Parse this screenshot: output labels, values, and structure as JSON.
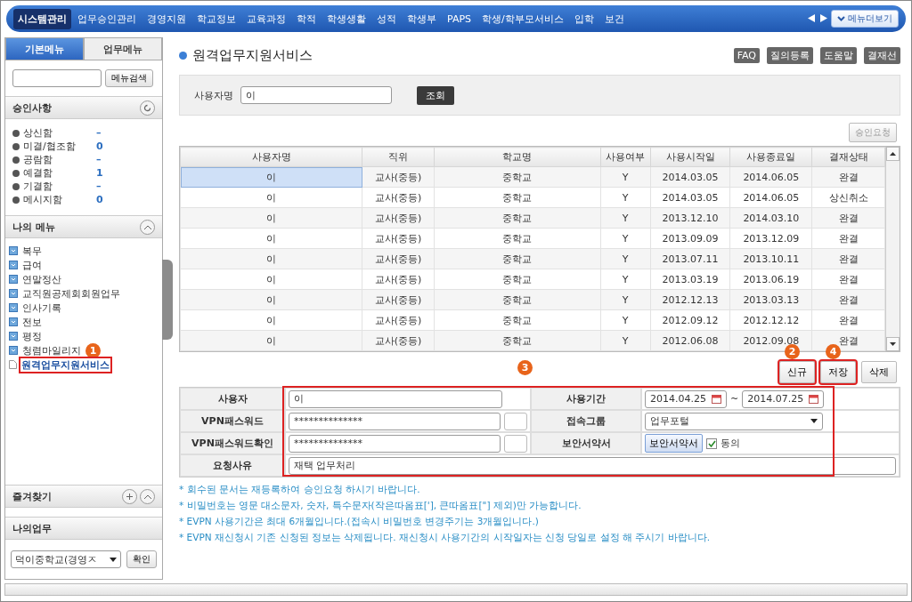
{
  "top_nav": {
    "items": [
      {
        "label": "시스템관리",
        "selected": true
      },
      {
        "label": "업무승인관리",
        "selected": false
      },
      {
        "label": "경영지원",
        "selected": false
      },
      {
        "label": "학교정보",
        "selected": false
      },
      {
        "label": "교육과정",
        "selected": false
      },
      {
        "label": "학적",
        "selected": false
      },
      {
        "label": "학생생활",
        "selected": false
      },
      {
        "label": "성적",
        "selected": false
      },
      {
        "label": "학생부",
        "selected": false
      },
      {
        "label": "PAPS",
        "selected": false
      },
      {
        "label": "학생/학부모서비스",
        "selected": false
      },
      {
        "label": "입학",
        "selected": false
      },
      {
        "label": "보건",
        "selected": false
      }
    ],
    "more_button": "메뉴더보기"
  },
  "sidebar": {
    "tabs": [
      {
        "label": "기본메뉴",
        "selected": true
      },
      {
        "label": "업무메뉴",
        "selected": false
      }
    ],
    "search_button": "메뉴검색",
    "approvals": {
      "title": "승인사항",
      "items": [
        {
          "label": "상신함",
          "count": "–"
        },
        {
          "label": "미결/협조함",
          "count": "0"
        },
        {
          "label": "공람함",
          "count": "–"
        },
        {
          "label": "예결함",
          "count": "1"
        },
        {
          "label": "기결함",
          "count": "–"
        },
        {
          "label": "메시지함",
          "count": "0"
        }
      ]
    },
    "my_menu": {
      "title": "나의 메뉴",
      "items": [
        {
          "label": "복무",
          "kind": "folder",
          "highlighted": false
        },
        {
          "label": "급여",
          "kind": "folder",
          "highlighted": false
        },
        {
          "label": "연말정산",
          "kind": "folder",
          "highlighted": false
        },
        {
          "label": "교직원공제회회원업무",
          "kind": "folder",
          "highlighted": false
        },
        {
          "label": "인사기록",
          "kind": "folder",
          "highlighted": false
        },
        {
          "label": "전보",
          "kind": "folder",
          "highlighted": false
        },
        {
          "label": "평정",
          "kind": "folder",
          "highlighted": false
        },
        {
          "label": "청렴마일리지",
          "kind": "folder",
          "highlighted": false,
          "marker": "1"
        },
        {
          "label": "원격업무지원서비스",
          "kind": "page",
          "highlighted": true
        }
      ]
    },
    "favorites": {
      "title": "즐겨찾기"
    },
    "my_work": {
      "title": "나의업무",
      "select_value": "덕이중학교(경영ㅈ",
      "confirm_button": "확인"
    }
  },
  "main": {
    "title": "원격업무지원서비스",
    "toolbar": [
      "FAQ",
      "질의등록",
      "도움말",
      "결재선"
    ],
    "search": {
      "label": "사용자명",
      "value": "이",
      "button": "조회"
    },
    "approve_button": "승인요청",
    "table": {
      "columns": [
        "사용자명",
        "직위",
        "학교명",
        "사용여부",
        "사용시작일",
        "사용종료일",
        "결재상태"
      ],
      "rows": [
        {
          "selected": true,
          "cells": [
            "이",
            "교사(중등)",
            "중학교",
            "Y",
            "2014.03.05",
            "2014.06.05",
            "완결"
          ]
        },
        {
          "selected": false,
          "cells": [
            "이",
            "교사(중등)",
            "중학교",
            "Y",
            "2014.03.05",
            "2014.06.05",
            "상신취소"
          ]
        },
        {
          "selected": false,
          "cells": [
            "이",
            "교사(중등)",
            "중학교",
            "Y",
            "2013.12.10",
            "2014.03.10",
            "완결"
          ]
        },
        {
          "selected": false,
          "cells": [
            "이",
            "교사(중등)",
            "중학교",
            "Y",
            "2013.09.09",
            "2013.12.09",
            "완결"
          ]
        },
        {
          "selected": false,
          "cells": [
            "이",
            "교사(중등)",
            "중학교",
            "Y",
            "2013.07.11",
            "2013.10.11",
            "완결"
          ]
        },
        {
          "selected": false,
          "cells": [
            "이",
            "교사(중등)",
            "중학교",
            "Y",
            "2013.03.19",
            "2013.06.19",
            "완결"
          ]
        },
        {
          "selected": false,
          "cells": [
            "이",
            "교사(중등)",
            "중학교",
            "Y",
            "2012.12.13",
            "2013.03.13",
            "완결"
          ]
        },
        {
          "selected": false,
          "cells": [
            "이",
            "교사(중등)",
            "중학교",
            "Y",
            "2012.09.12",
            "2012.12.12",
            "완결"
          ]
        },
        {
          "selected": false,
          "cells": [
            "이",
            "교사(중등)",
            "중학교",
            "Y",
            "2012.06.08",
            "2012.09.08",
            "완결"
          ]
        }
      ]
    },
    "form_marker": "3",
    "actions": [
      {
        "label": "신규",
        "highlighted": true,
        "marker": "2"
      },
      {
        "label": "저장",
        "highlighted": true,
        "marker": "4"
      },
      {
        "label": "삭제",
        "highlighted": false
      }
    ],
    "form": {
      "user_label": "사용자",
      "user_value": "이",
      "period_label": "사용기간",
      "period_start": "2014.04.25",
      "period_sep": "~",
      "period_end": "2014.07.25",
      "vpn_label": "VPN패스워드",
      "vpn_value": "**************",
      "group_label": "접속그룹",
      "group_value": "업무포털",
      "vpn_confirm_label": "VPN패스워드확인",
      "vpn_confirm_value": "**************",
      "agreement_label": "보안서약서",
      "agreement_button": "보안서약서",
      "agree_label": "동의",
      "agree_checked": true,
      "reason_label": "요청사유",
      "reason_value": "재택 업무처리"
    },
    "notes": [
      "* 회수된 문서는 재등록하여 승인요청 하시기 바랍니다.",
      "* 비밀번호는 영문 대소문자, 숫자, 특수문자(작은따옴표['], 큰따옴표[\"] 제외)만 가능합니다.",
      "* EVPN 사용기간은 최대 6개월입니다.(접속시 비밀번호 변경주기는 3개월입니다.)",
      "* EVPN 재신청시 기존 신청된 정보는 삭제됩니다. 재신청시 사용기간의 시작일자는 신청 당일로 설정 해 주시기 바랍니다."
    ]
  }
}
